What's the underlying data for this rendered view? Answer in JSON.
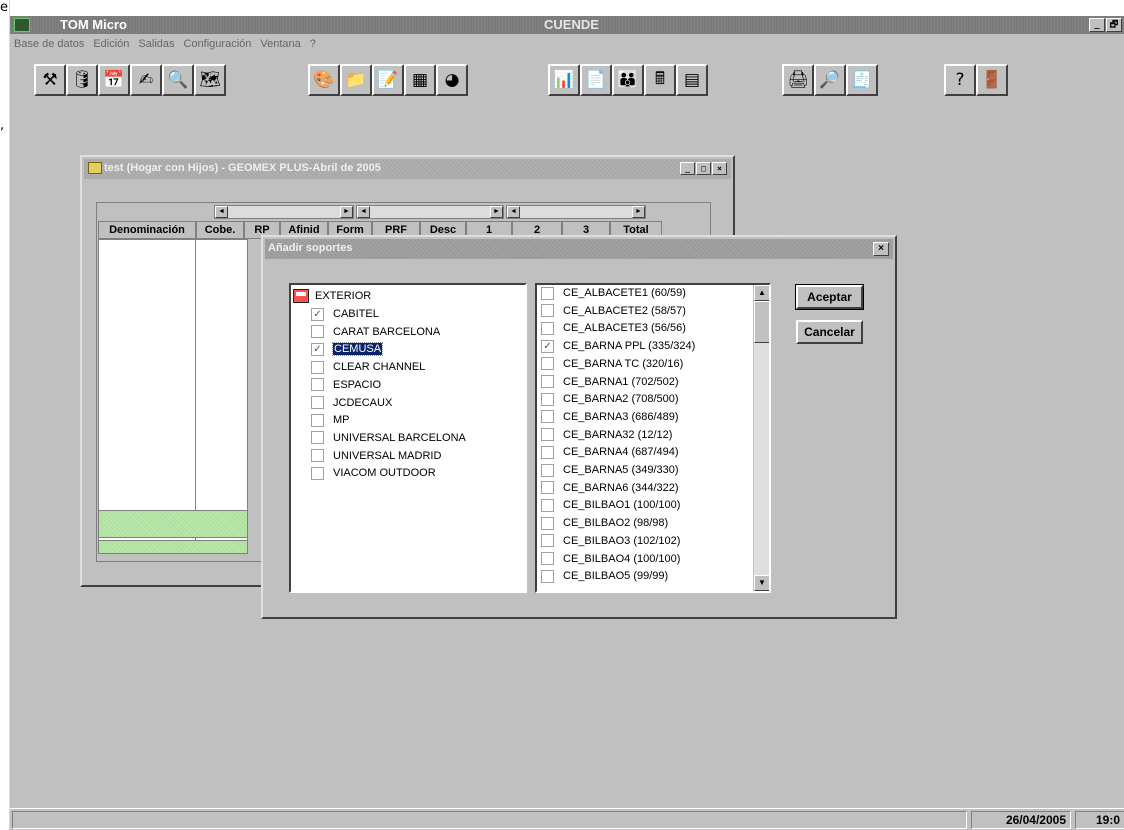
{
  "app": {
    "name": "TOM Micro",
    "center_title": "CUENDE",
    "window_buttons": [
      "_",
      "🗗"
    ]
  },
  "left_marks": [
    "e",
    ","
  ],
  "menu": [
    "Base de datos",
    "Edición",
    "Salidas",
    "Configuración",
    "Ventana",
    "?"
  ],
  "toolbar": {
    "buttons": [
      {
        "name": "faucet-icon",
        "glyph": "⚒"
      },
      {
        "name": "database-icon",
        "glyph": "🛢"
      },
      {
        "name": "calendar-icon",
        "glyph": "📅"
      },
      {
        "name": "edit-pen-icon",
        "glyph": "✍"
      },
      {
        "name": "search-pages-icon",
        "glyph": "🔍"
      },
      {
        "name": "map-icon",
        "glyph": "🗺"
      },
      {
        "name": "color-wheel-icon",
        "glyph": "🎨"
      },
      {
        "name": "folder-icon",
        "glyph": "📁"
      },
      {
        "name": "edit-document-icon",
        "glyph": "📝"
      },
      {
        "name": "grid-chart-icon",
        "glyph": "▦"
      },
      {
        "name": "pie-chart-icon",
        "glyph": "◕"
      },
      {
        "name": "bar-chart-icon",
        "glyph": "📊"
      },
      {
        "name": "notes-icon",
        "glyph": "📄"
      },
      {
        "name": "people-icon",
        "glyph": "👪"
      },
      {
        "name": "calculator-icon",
        "glyph": "🖩"
      },
      {
        "name": "spreadsheet-icon",
        "glyph": "▤"
      },
      {
        "name": "print-icon",
        "glyph": "🖨"
      },
      {
        "name": "print-preview-icon",
        "glyph": "🔎"
      },
      {
        "name": "report-icon",
        "glyph": "🧾"
      },
      {
        "name": "help-icon",
        "glyph": "?"
      },
      {
        "name": "exit-icon",
        "glyph": "🚪"
      }
    ]
  },
  "background_window": {
    "title": "test (Hogar con Hijos) - GEOMEX PLUS-Abril de 2005",
    "buttons": [
      "_",
      "□",
      "×"
    ],
    "columns": [
      "Denominación",
      "Cobe.",
      "RP",
      "Afinid",
      "Form",
      "PRF",
      "Desc",
      "1",
      "2",
      "3",
      "Total"
    ]
  },
  "dialog": {
    "title": "Añadir soportes",
    "close": "×",
    "tree_root": "EXTERIOR",
    "tree_items": [
      {
        "label": "CABITEL",
        "checked": true
      },
      {
        "label": "CARAT BARCELONA",
        "checked": false
      },
      {
        "label": "CEMUSA",
        "checked": true,
        "selected": true
      },
      {
        "label": "CLEAR CHANNEL",
        "checked": false
      },
      {
        "label": "ESPACIO",
        "checked": false
      },
      {
        "label": "JCDECAUX",
        "checked": false
      },
      {
        "label": "MP",
        "checked": false
      },
      {
        "label": "UNIVERSAL BARCELONA",
        "checked": false
      },
      {
        "label": "UNIVERSAL MADRID",
        "checked": false
      },
      {
        "label": "VIACOM OUTDOOR",
        "checked": false
      }
    ],
    "supports": [
      {
        "label": "CE_ALBACETE1 (60/59)",
        "checked": false
      },
      {
        "label": "CE_ALBACETE2 (58/57)",
        "checked": false
      },
      {
        "label": "CE_ALBACETE3 (56/56)",
        "checked": false
      },
      {
        "label": "CE_BARNA PPL (335/324)",
        "checked": true
      },
      {
        "label": "CE_BARNA TC (320/16)",
        "checked": false
      },
      {
        "label": "CE_BARNA1 (702/502)",
        "checked": false
      },
      {
        "label": "CE_BARNA2 (708/500)",
        "checked": false
      },
      {
        "label": "CE_BARNA3 (686/489)",
        "checked": false
      },
      {
        "label": "CE_BARNA32 (12/12)",
        "checked": false
      },
      {
        "label": "CE_BARNA4 (687/494)",
        "checked": false
      },
      {
        "label": "CE_BARNA5 (349/330)",
        "checked": false
      },
      {
        "label": "CE_BARNA6 (344/322)",
        "checked": false
      },
      {
        "label": "CE_BILBAO1 (100/100)",
        "checked": false
      },
      {
        "label": "CE_BILBAO2 (98/98)",
        "checked": false
      },
      {
        "label": "CE_BILBAO3 (102/102)",
        "checked": false
      },
      {
        "label": "CE_BILBAO4 (100/100)",
        "checked": false
      },
      {
        "label": "CE_BILBAO5 (99/99)",
        "checked": false
      }
    ],
    "accept_label": "Aceptar",
    "cancel_label": "Cancelar",
    "scroll_up": "▲",
    "scroll_down": "▼"
  },
  "status": {
    "date": "26/04/2005",
    "time": "19:0"
  }
}
